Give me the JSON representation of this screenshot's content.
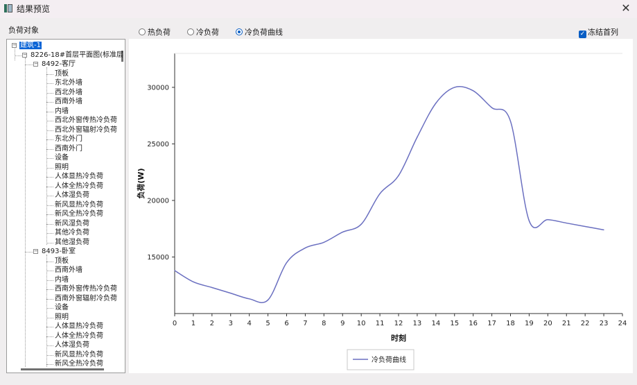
{
  "window": {
    "title": "结果预览",
    "close_icon": "close-icon"
  },
  "left_panel": {
    "label": "负荷对象"
  },
  "tree": {
    "root": "建筑-1",
    "floor": "8226-18#首层平面图(标准层",
    "rooms": [
      {
        "name": "8492-客厅",
        "items": [
          "顶板",
          "东北外墙",
          "西北外墙",
          "西南外墙",
          "内墙",
          "西北外窗传热冷负荷",
          "西北外窗辐射冷负荷",
          "东北外门",
          "西南外门",
          "设备",
          "照明",
          "人体显热冷负荷",
          "人体全热冷负荷",
          "人体湿负荷",
          "新风显热冷负荷",
          "新风全热冷负荷",
          "新风湿负荷",
          "其他冷负荷",
          "其他湿负荷"
        ]
      },
      {
        "name": "8493-卧室",
        "items": [
          "顶板",
          "西南外墙",
          "内墙",
          "西南外窗传热冷负荷",
          "西南外窗辐射冷负荷",
          "设备",
          "照明",
          "人体显热冷负荷",
          "人体全热冷负荷",
          "人体湿负荷",
          "新风显热冷负荷",
          "新风全热冷负荷"
        ]
      }
    ]
  },
  "options": {
    "radios": [
      {
        "label": "热负荷",
        "selected": false
      },
      {
        "label": "冷负荷",
        "selected": false
      },
      {
        "label": "冷负荷曲线",
        "selected": true
      }
    ],
    "freeze_first_column": {
      "label": "冻结首列",
      "checked": true
    }
  },
  "chart_data": {
    "type": "line",
    "xlabel": "时刻",
    "ylabel": "负荷(W)",
    "xlim": [
      0,
      24
    ],
    "ylim": [
      10000,
      33000
    ],
    "x_ticks": [
      "0",
      "1",
      "2",
      "3",
      "4",
      "5",
      "6",
      "7",
      "8",
      "9",
      "10",
      "11",
      "12",
      "13",
      "14",
      "15",
      "16",
      "17",
      "18",
      "19",
      "20",
      "21",
      "22",
      "23",
      "24"
    ],
    "y_ticks": [
      "15000",
      "20000",
      "25000",
      "30000"
    ],
    "series": [
      {
        "name": "冷负荷曲线",
        "color": "#6a6fc0",
        "x": [
          0,
          1,
          2,
          3,
          4,
          5,
          6,
          7,
          8,
          9,
          10,
          11,
          12,
          13,
          14,
          15,
          16,
          17,
          18,
          19,
          20,
          21,
          22,
          23
        ],
        "y": [
          13800,
          12800,
          12300,
          11800,
          11300,
          11200,
          14500,
          15800,
          16300,
          17200,
          17900,
          20600,
          22200,
          25600,
          28600,
          30000,
          29700,
          28200,
          27000,
          18200,
          18300,
          18000,
          17700,
          17400
        ]
      }
    ],
    "legend": {
      "position": "bottom-center"
    },
    "grid": false
  }
}
